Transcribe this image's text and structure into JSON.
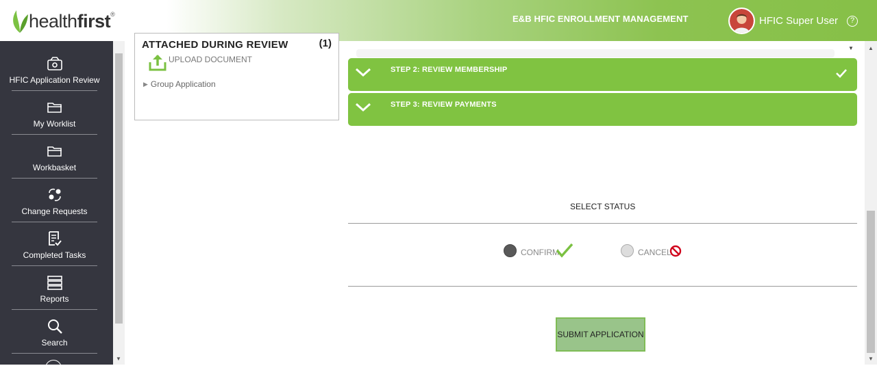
{
  "header": {
    "logo": {
      "prefix": "health",
      "bold": "first",
      "reg": "®"
    },
    "app_title": "E&B HFIC ENROLLMENT MANAGEMENT",
    "user_name": "HFIC Super User",
    "help": "?"
  },
  "sidebar": {
    "items": [
      {
        "label": "HFIC Application Review",
        "icon": "application-review-icon"
      },
      {
        "label": "My Worklist",
        "icon": "folder-icon"
      },
      {
        "label": "Workbasket",
        "icon": "folder-icon"
      },
      {
        "label": "Change Requests",
        "icon": "change-request-icon"
      },
      {
        "label": "Completed Tasks",
        "icon": "completed-tasks-icon"
      },
      {
        "label": "Reports",
        "icon": "reports-icon"
      },
      {
        "label": "Search",
        "icon": "search-icon"
      }
    ]
  },
  "documents": {
    "heading": "ATTACHED DURING REVIEW",
    "count": "(1)",
    "upload_label": "UPLOAD DOCUMENT",
    "group_label": "Group Application"
  },
  "steps": [
    {
      "label": "STEP 2: REVIEW MEMBERSHIP",
      "completed": true
    },
    {
      "label": "STEP 3: REVIEW PAYMENTS",
      "completed": false
    }
  ],
  "status": {
    "heading": "SELECT STATUS",
    "options": [
      {
        "label": "CONFIRM",
        "selected": true
      },
      {
        "label": "CANCEL",
        "selected": false
      }
    ],
    "submit_label": "SUBMIT APPLICATION"
  },
  "colors": {
    "accent": "#80c341",
    "sidebar_bg": "#35363f",
    "cancel_red": "#d0021b"
  }
}
